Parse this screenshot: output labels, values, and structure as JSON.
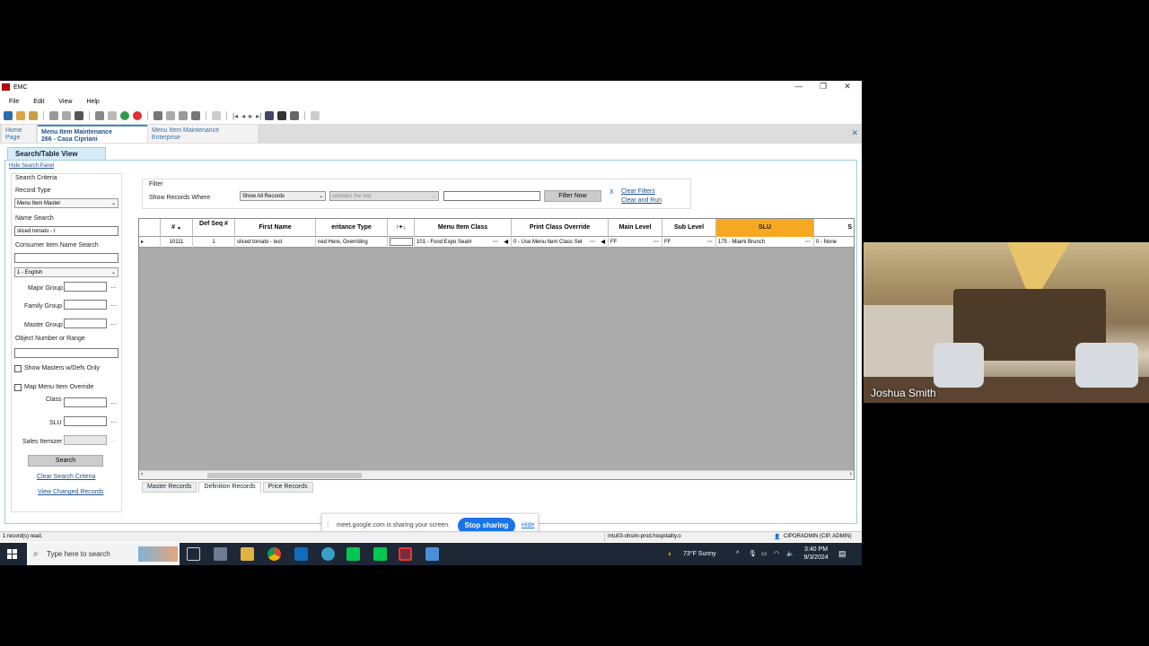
{
  "window": {
    "title": "EMC"
  },
  "menu": [
    "File",
    "Edit",
    "View",
    "Help"
  ],
  "tabs": [
    {
      "line1": "Home",
      "line2": "Page"
    },
    {
      "line1": "Menu Item Maintenance",
      "line2": "266 - Casa Cipriani"
    },
    {
      "line1": "Menu Item Maintenance",
      "line2": "Enterprise"
    }
  ],
  "view_tab": "Search/Table View",
  "hide_search_panel": "Hide Search Panel",
  "search": {
    "title": "Search Criteria",
    "record_type_label": "Record Type",
    "record_type_value": "Menu Item Master",
    "name_search_label": "Name Search",
    "name_search_value": "sliced tomato - t",
    "consumer_label": "Consumer Item Name Search",
    "consumer_value": "",
    "language_value": "1 - English",
    "major_group_label": "Major Group",
    "family_group_label": "Family Group",
    "master_group_label": "Master Group",
    "object_number_label": "Object Number or Range",
    "show_masters_label": "Show Masters w/Defs Only",
    "map_override_label": "Map Menu Item Override",
    "class_label": "Class",
    "slu_label": "SLU",
    "sales_itemizer_label": "Sales Itemizer",
    "search_button": "Search",
    "clear_link": "Clear Search Criteria",
    "view_changed_link": "View Changed Records"
  },
  "filter": {
    "title": "Filter",
    "show_records_label": "Show Records Where",
    "show_records_value": "Show All Records",
    "condition_value": "contains the text",
    "text_value": "",
    "filter_now": "Filter Now",
    "x": "X",
    "clear_filters": "Clear Filters",
    "clear_and_run": "Clear and Run"
  },
  "grid": {
    "columns": [
      "#",
      "Def Seq #",
      "First Name",
      "eritance Type",
      "↑+↓",
      "Menu Item Class",
      "Print Class Override",
      "Main Level",
      "Sub Level",
      "SLU",
      "S"
    ],
    "rows": [
      [
        "10111",
        "1",
        "sliced tomato - test",
        "ned Here, Overriding",
        "",
        "101 - Food Expo Seat#",
        "0 - Use Menu Item Class Set",
        "FF",
        "FF",
        "175 - Miami Brunch",
        "0 - None"
      ]
    ]
  },
  "bottom_tabs": [
    "Master Records",
    "Definition Records",
    "Price Records"
  ],
  "share_bar": {
    "text": "meet.google.com is sharing your screen.",
    "stop": "Stop sharing",
    "hide": "Hide"
  },
  "status": {
    "left": "1 record(s) read.",
    "server": "mtu03-ohsim-prod.hospitality.o",
    "user": "CIPORADMIN (CIP, ADMIN)"
  },
  "taskbar": {
    "search_placeholder": "Type here to search",
    "weather": "73°F  Sunny",
    "time": "3:40 PM",
    "date": "9/3/2024"
  },
  "video": {
    "participant": "Joshua Smith"
  },
  "colors": {
    "slu_header": "#f7a823",
    "stop_button": "#1a73e8",
    "link": "#1f4f8a"
  }
}
